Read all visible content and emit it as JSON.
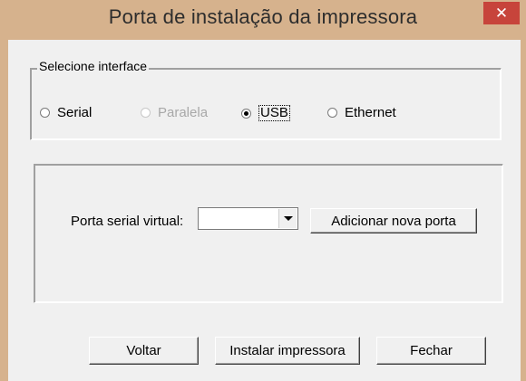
{
  "window": {
    "title": "Porta de instalação da impressora",
    "close_glyph": "✕"
  },
  "interface_group": {
    "legend": "Selecione interface",
    "options": [
      {
        "label": "Serial",
        "selected": false,
        "enabled": true
      },
      {
        "label": "Paralela",
        "selected": false,
        "enabled": false
      },
      {
        "label": "USB",
        "selected": true,
        "enabled": true
      },
      {
        "label": "Ethernet",
        "selected": false,
        "enabled": true
      }
    ]
  },
  "port_group": {
    "field_label": "Porta serial virtual:",
    "combo_value": "",
    "add_port_button": "Adicionar nova porta"
  },
  "footer": {
    "back_button": "Voltar",
    "install_button": "Instalar impressora",
    "close_button": "Fechar"
  },
  "colors": {
    "titlebar": "#d6b28d",
    "close_button": "#c7443b",
    "dialog_bg": "#f0f0f0"
  }
}
